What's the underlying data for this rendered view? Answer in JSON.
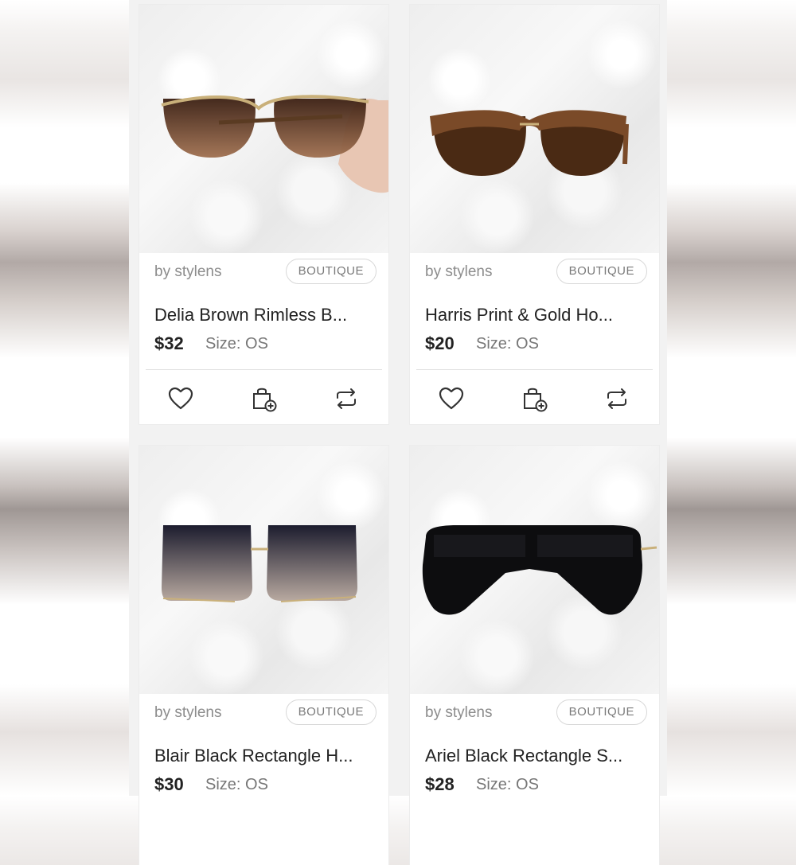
{
  "products": [
    {
      "seller": "by stylens",
      "badge": "BOUTIQUE",
      "title": "Delia Brown Rimless B...",
      "price": "$32",
      "size": "Size: OS",
      "image": "brown rimless sunglasses held by hand on white fur"
    },
    {
      "seller": "by stylens",
      "badge": "BOUTIQUE",
      "title": "Harris Print & Gold Ho...",
      "price": "$20",
      "size": "Size: OS",
      "image": "tortoise print clubmaster sunglasses on white fur"
    },
    {
      "seller": "by stylens",
      "badge": "BOUTIQUE",
      "title": "Blair Black Rectangle H...",
      "price": "$30",
      "size": "Size: OS",
      "image": "black square rimless sunglasses on white fur"
    },
    {
      "seller": "by stylens",
      "badge": "BOUTIQUE",
      "title": "Ariel Black Rectangle S...",
      "price": "$28",
      "size": "Size: OS",
      "image": "black oversized shield sunglasses on white fur"
    }
  ],
  "actions": [
    "heart-icon",
    "add-to-bundle-icon",
    "share-icon"
  ]
}
